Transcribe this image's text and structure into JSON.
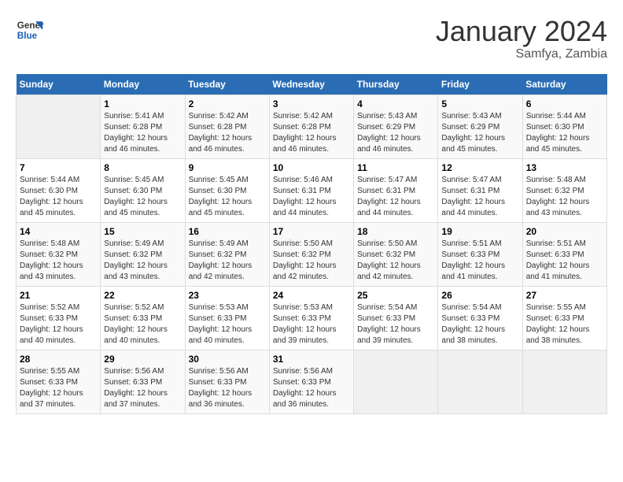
{
  "header": {
    "logo_line1": "General",
    "logo_line2": "Blue",
    "month": "January 2024",
    "location": "Samfya, Zambia"
  },
  "weekdays": [
    "Sunday",
    "Monday",
    "Tuesday",
    "Wednesday",
    "Thursday",
    "Friday",
    "Saturday"
  ],
  "weeks": [
    [
      {
        "day": "",
        "sunrise": "",
        "sunset": "",
        "daylight": ""
      },
      {
        "day": "1",
        "sunrise": "Sunrise: 5:41 AM",
        "sunset": "Sunset: 6:28 PM",
        "daylight": "Daylight: 12 hours and 46 minutes."
      },
      {
        "day": "2",
        "sunrise": "Sunrise: 5:42 AM",
        "sunset": "Sunset: 6:28 PM",
        "daylight": "Daylight: 12 hours and 46 minutes."
      },
      {
        "day": "3",
        "sunrise": "Sunrise: 5:42 AM",
        "sunset": "Sunset: 6:28 PM",
        "daylight": "Daylight: 12 hours and 46 minutes."
      },
      {
        "day": "4",
        "sunrise": "Sunrise: 5:43 AM",
        "sunset": "Sunset: 6:29 PM",
        "daylight": "Daylight: 12 hours and 46 minutes."
      },
      {
        "day": "5",
        "sunrise": "Sunrise: 5:43 AM",
        "sunset": "Sunset: 6:29 PM",
        "daylight": "Daylight: 12 hours and 45 minutes."
      },
      {
        "day": "6",
        "sunrise": "Sunrise: 5:44 AM",
        "sunset": "Sunset: 6:30 PM",
        "daylight": "Daylight: 12 hours and 45 minutes."
      }
    ],
    [
      {
        "day": "7",
        "sunrise": "Sunrise: 5:44 AM",
        "sunset": "Sunset: 6:30 PM",
        "daylight": "Daylight: 12 hours and 45 minutes."
      },
      {
        "day": "8",
        "sunrise": "Sunrise: 5:45 AM",
        "sunset": "Sunset: 6:30 PM",
        "daylight": "Daylight: 12 hours and 45 minutes."
      },
      {
        "day": "9",
        "sunrise": "Sunrise: 5:45 AM",
        "sunset": "Sunset: 6:30 PM",
        "daylight": "Daylight: 12 hours and 45 minutes."
      },
      {
        "day": "10",
        "sunrise": "Sunrise: 5:46 AM",
        "sunset": "Sunset: 6:31 PM",
        "daylight": "Daylight: 12 hours and 44 minutes."
      },
      {
        "day": "11",
        "sunrise": "Sunrise: 5:47 AM",
        "sunset": "Sunset: 6:31 PM",
        "daylight": "Daylight: 12 hours and 44 minutes."
      },
      {
        "day": "12",
        "sunrise": "Sunrise: 5:47 AM",
        "sunset": "Sunset: 6:31 PM",
        "daylight": "Daylight: 12 hours and 44 minutes."
      },
      {
        "day": "13",
        "sunrise": "Sunrise: 5:48 AM",
        "sunset": "Sunset: 6:32 PM",
        "daylight": "Daylight: 12 hours and 43 minutes."
      }
    ],
    [
      {
        "day": "14",
        "sunrise": "Sunrise: 5:48 AM",
        "sunset": "Sunset: 6:32 PM",
        "daylight": "Daylight: 12 hours and 43 minutes."
      },
      {
        "day": "15",
        "sunrise": "Sunrise: 5:49 AM",
        "sunset": "Sunset: 6:32 PM",
        "daylight": "Daylight: 12 hours and 43 minutes."
      },
      {
        "day": "16",
        "sunrise": "Sunrise: 5:49 AM",
        "sunset": "Sunset: 6:32 PM",
        "daylight": "Daylight: 12 hours and 42 minutes."
      },
      {
        "day": "17",
        "sunrise": "Sunrise: 5:50 AM",
        "sunset": "Sunset: 6:32 PM",
        "daylight": "Daylight: 12 hours and 42 minutes."
      },
      {
        "day": "18",
        "sunrise": "Sunrise: 5:50 AM",
        "sunset": "Sunset: 6:32 PM",
        "daylight": "Daylight: 12 hours and 42 minutes."
      },
      {
        "day": "19",
        "sunrise": "Sunrise: 5:51 AM",
        "sunset": "Sunset: 6:33 PM",
        "daylight": "Daylight: 12 hours and 41 minutes."
      },
      {
        "day": "20",
        "sunrise": "Sunrise: 5:51 AM",
        "sunset": "Sunset: 6:33 PM",
        "daylight": "Daylight: 12 hours and 41 minutes."
      }
    ],
    [
      {
        "day": "21",
        "sunrise": "Sunrise: 5:52 AM",
        "sunset": "Sunset: 6:33 PM",
        "daylight": "Daylight: 12 hours and 40 minutes."
      },
      {
        "day": "22",
        "sunrise": "Sunrise: 5:52 AM",
        "sunset": "Sunset: 6:33 PM",
        "daylight": "Daylight: 12 hours and 40 minutes."
      },
      {
        "day": "23",
        "sunrise": "Sunrise: 5:53 AM",
        "sunset": "Sunset: 6:33 PM",
        "daylight": "Daylight: 12 hours and 40 minutes."
      },
      {
        "day": "24",
        "sunrise": "Sunrise: 5:53 AM",
        "sunset": "Sunset: 6:33 PM",
        "daylight": "Daylight: 12 hours and 39 minutes."
      },
      {
        "day": "25",
        "sunrise": "Sunrise: 5:54 AM",
        "sunset": "Sunset: 6:33 PM",
        "daylight": "Daylight: 12 hours and 39 minutes."
      },
      {
        "day": "26",
        "sunrise": "Sunrise: 5:54 AM",
        "sunset": "Sunset: 6:33 PM",
        "daylight": "Daylight: 12 hours and 38 minutes."
      },
      {
        "day": "27",
        "sunrise": "Sunrise: 5:55 AM",
        "sunset": "Sunset: 6:33 PM",
        "daylight": "Daylight: 12 hours and 38 minutes."
      }
    ],
    [
      {
        "day": "28",
        "sunrise": "Sunrise: 5:55 AM",
        "sunset": "Sunset: 6:33 PM",
        "daylight": "Daylight: 12 hours and 37 minutes."
      },
      {
        "day": "29",
        "sunrise": "Sunrise: 5:56 AM",
        "sunset": "Sunset: 6:33 PM",
        "daylight": "Daylight: 12 hours and 37 minutes."
      },
      {
        "day": "30",
        "sunrise": "Sunrise: 5:56 AM",
        "sunset": "Sunset: 6:33 PM",
        "daylight": "Daylight: 12 hours and 36 minutes."
      },
      {
        "day": "31",
        "sunrise": "Sunrise: 5:56 AM",
        "sunset": "Sunset: 6:33 PM",
        "daylight": "Daylight: 12 hours and 36 minutes."
      },
      {
        "day": "",
        "sunrise": "",
        "sunset": "",
        "daylight": ""
      },
      {
        "day": "",
        "sunrise": "",
        "sunset": "",
        "daylight": ""
      },
      {
        "day": "",
        "sunrise": "",
        "sunset": "",
        "daylight": ""
      }
    ]
  ]
}
